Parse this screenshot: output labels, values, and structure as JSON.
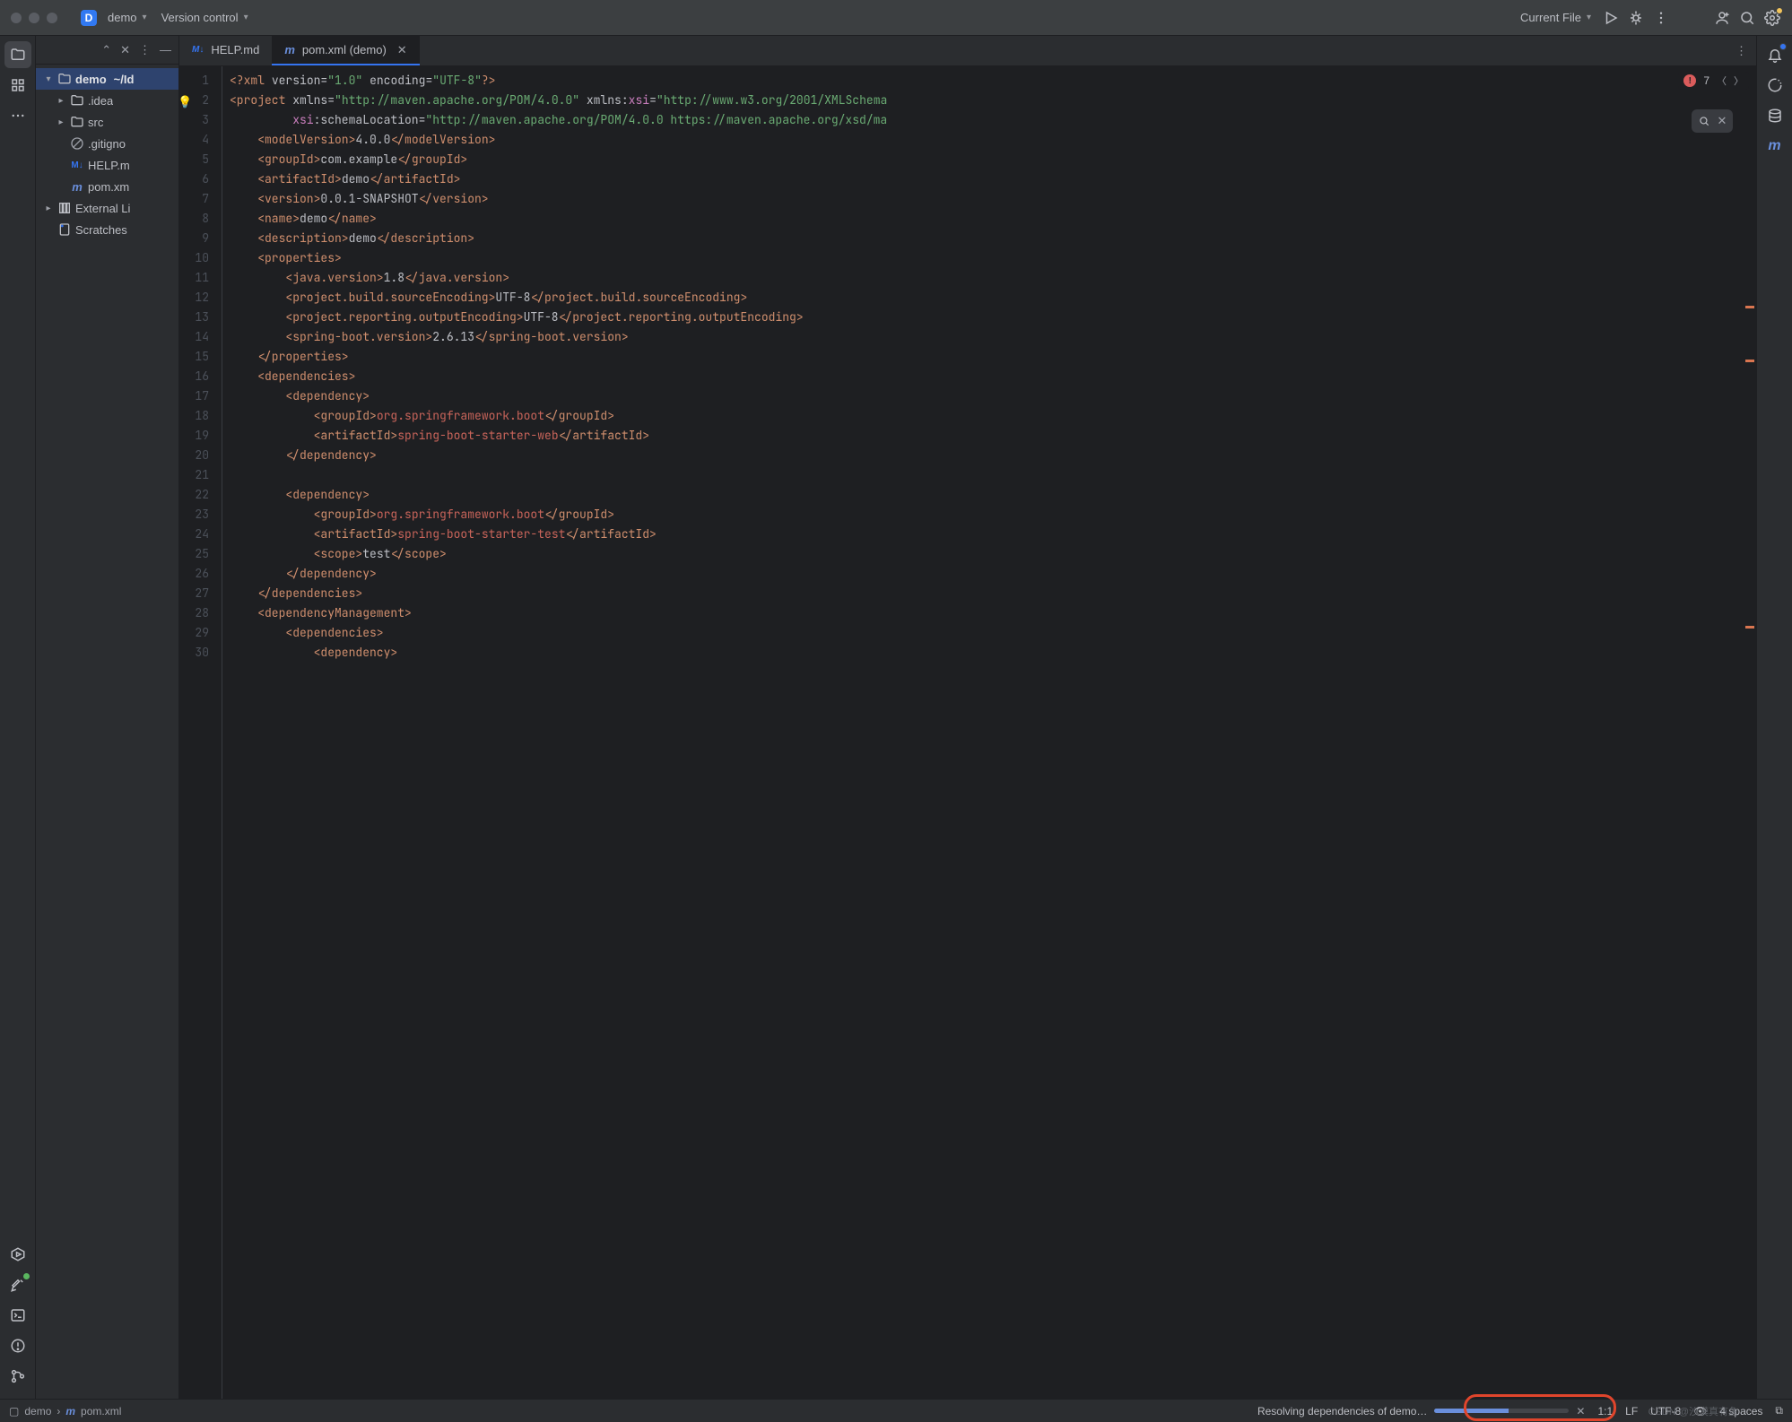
{
  "titlebar": {
    "project_icon_letter": "D",
    "project_name": "demo",
    "vcs_label": "Version control",
    "run_config": "Current File"
  },
  "left_strip": {
    "buttons": [
      "folder",
      "structure",
      "more"
    ],
    "bottom": [
      "services",
      "todo",
      "terminal",
      "problems",
      "git"
    ]
  },
  "right_strip": {
    "buttons": [
      "notifications",
      "ai",
      "database",
      "maven"
    ]
  },
  "project_tree": {
    "root": {
      "name": "demo",
      "hint": "~/Id"
    },
    "children": [
      {
        "name": ".idea",
        "kind": "folder"
      },
      {
        "name": "src",
        "kind": "folder"
      },
      {
        "name": ".gitignore",
        "kind": "ignore",
        "display": ".gitigno"
      },
      {
        "name": "HELP.md",
        "kind": "md",
        "display": "HELP.m"
      },
      {
        "name": "pom.xml",
        "kind": "maven",
        "display": "pom.xm"
      }
    ],
    "external": "External Li",
    "scratches": "Scratches"
  },
  "tabs": [
    {
      "icon": "M↓",
      "label": "HELP.md",
      "active": false,
      "icon_class": "md-ic"
    },
    {
      "icon": "m",
      "label": "pom.xml (demo)",
      "active": true,
      "icon_class": "m-ic"
    }
  ],
  "inspection": {
    "error_count": "7"
  },
  "code_lines": [
    {
      "n": 1,
      "html": "<span class='pi'>&lt;?xml</span> <span class='attr'>version=</span><span class='piq'>\"1.0\"</span> <span class='attr'>encoding=</span><span class='piq'>\"UTF-8\"</span><span class='pi'>?&gt;</span>"
    },
    {
      "n": 2,
      "html": "<span class='tag'>&lt;project</span> <span class='attr'>xmlns=</span><span class='str'>\"http://maven.apache.org/POM/4.0.0\"</span> <span class='attr'>xmlns:</span><span class='ns'>xsi</span><span class='attr'>=</span><span class='str'>\"http://www.w3.org/2001/XMLSchema</span>",
      "bulb": true
    },
    {
      "n": 3,
      "html": "         <span class='ns'>xsi</span><span class='attr'>:schemaLocation=</span><span class='str'>\"http://maven.apache.org/POM/4.0.0 https://maven.apache.org/xsd/ma</span>"
    },
    {
      "n": 4,
      "html": "    <span class='tag'>&lt;modelVersion&gt;</span>4.0.0<span class='tag'>&lt;/modelVersion&gt;</span>"
    },
    {
      "n": 5,
      "html": "    <span class='tag'>&lt;groupId&gt;</span>com.example<span class='tag'>&lt;/groupId&gt;</span>"
    },
    {
      "n": 6,
      "html": "    <span class='tag'>&lt;artifactId&gt;</span>demo<span class='tag'>&lt;/artifactId&gt;</span>"
    },
    {
      "n": 7,
      "html": "    <span class='tag'>&lt;version&gt;</span>0.0.1-SNAPSHOT<span class='tag'>&lt;/version&gt;</span>"
    },
    {
      "n": 8,
      "html": "    <span class='tag'>&lt;name&gt;</span>demo<span class='tag'>&lt;/name&gt;</span>"
    },
    {
      "n": 9,
      "html": "    <span class='tag'>&lt;description&gt;</span>demo<span class='tag'>&lt;/description&gt;</span>"
    },
    {
      "n": 10,
      "html": "    <span class='tag'>&lt;properties&gt;</span>"
    },
    {
      "n": 11,
      "html": "        <span class='tag'>&lt;java.version&gt;</span>1.8<span class='tag'>&lt;/java.version&gt;</span>"
    },
    {
      "n": 12,
      "html": "        <span class='tag'>&lt;project.build.sourceEncoding&gt;</span>UTF-8<span class='tag'>&lt;/project.build.sourceEncoding&gt;</span>"
    },
    {
      "n": 13,
      "html": "        <span class='tag'>&lt;project.reporting.outputEncoding&gt;</span>UTF-8<span class='tag'>&lt;/project.reporting.outputEncoding&gt;</span>"
    },
    {
      "n": 14,
      "html": "        <span class='tag'>&lt;spring-boot.version&gt;</span>2.6.13<span class='tag'>&lt;/spring-boot.version&gt;</span>"
    },
    {
      "n": 15,
      "html": "    <span class='tag'>&lt;/properties&gt;</span>"
    },
    {
      "n": 16,
      "html": "    <span class='tag'>&lt;dependencies&gt;</span>"
    },
    {
      "n": 17,
      "html": "        <span class='tag'>&lt;dependency&gt;</span>"
    },
    {
      "n": 18,
      "html": "            <span class='tag'>&lt;groupId&gt;</span><span class='txt-hl'>org.springframework.boot</span><span class='tag'>&lt;/groupId&gt;</span>"
    },
    {
      "n": 19,
      "html": "            <span class='tag'>&lt;artifactId&gt;</span><span class='txt-hl'>spring-boot-starter-web</span><span class='tag'>&lt;/artifactId&gt;</span>"
    },
    {
      "n": 20,
      "html": "        <span class='tag'>&lt;/dependency&gt;</span>"
    },
    {
      "n": 21,
      "html": ""
    },
    {
      "n": 22,
      "html": "        <span class='tag'>&lt;dependency&gt;</span>"
    },
    {
      "n": 23,
      "html": "            <span class='tag'>&lt;groupId&gt;</span><span class='txt-hl'>org.springframework.boot</span><span class='tag'>&lt;/groupId&gt;</span>"
    },
    {
      "n": 24,
      "html": "            <span class='tag'>&lt;artifactId&gt;</span><span class='txt-hl'>spring-boot-starter-test</span><span class='tag'>&lt;/artifactId&gt;</span>"
    },
    {
      "n": 25,
      "html": "            <span class='tag'>&lt;scope&gt;</span>test<span class='tag'>&lt;/scope&gt;</span>"
    },
    {
      "n": 26,
      "html": "        <span class='tag'>&lt;/dependency&gt;</span>"
    },
    {
      "n": 27,
      "html": "    <span class='tag'>&lt;/dependencies&gt;</span>"
    },
    {
      "n": 28,
      "html": "    <span class='tag'>&lt;dependencyManagement&gt;</span>"
    },
    {
      "n": 29,
      "html": "        <span class='tag'>&lt;dependencies&gt;</span>"
    },
    {
      "n": 30,
      "html": "            <span class='tag'>&lt;dependency&gt;</span>"
    }
  ],
  "status": {
    "crumb_module": "demo",
    "crumb_file": "pom.xml",
    "task": "Resolving dependencies of demo…",
    "pos": "1:1",
    "line_sep": "LF",
    "encoding": "UTF-8",
    "indent": "4 spaces"
  },
  "watermark": "CSDN @沙漠真有鱼"
}
